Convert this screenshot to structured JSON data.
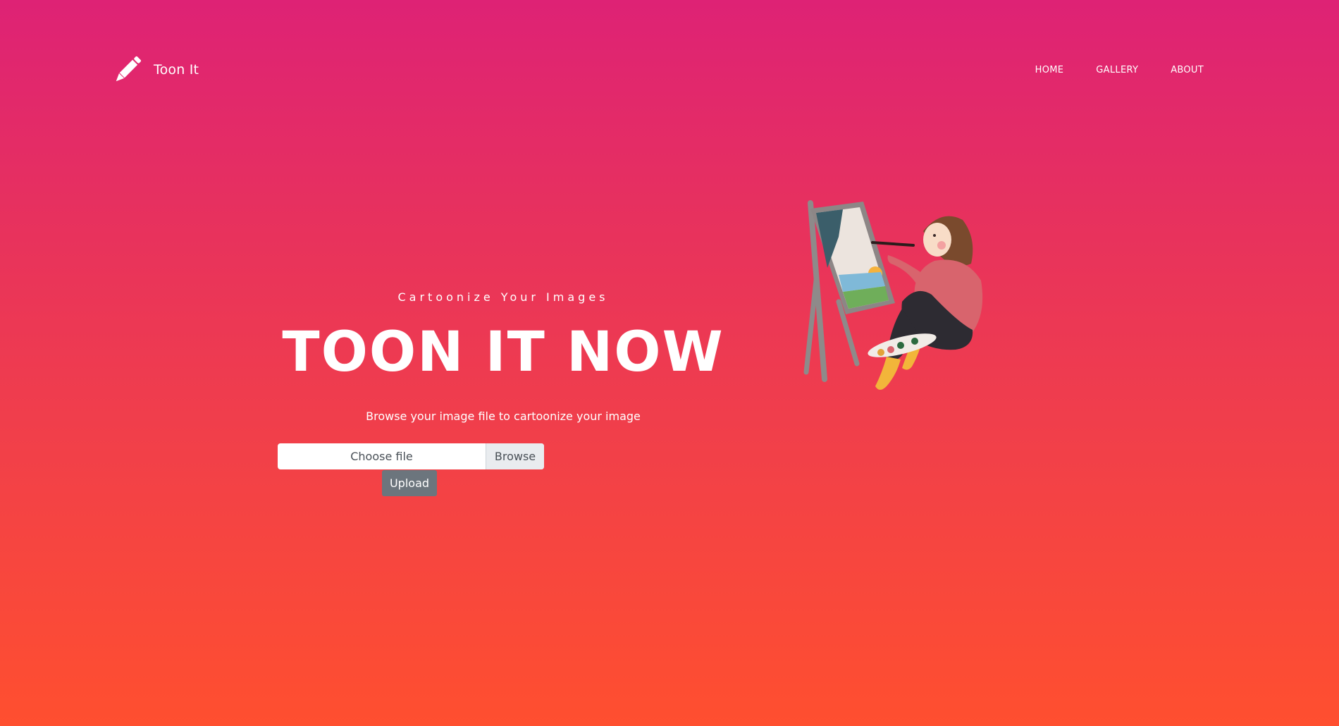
{
  "header": {
    "brand": "Toon It",
    "nav": [
      "HOME",
      "GALLERY",
      "ABOUT"
    ]
  },
  "hero": {
    "subtitle": "Cartoonize Your Images",
    "title": "TOON IT NOW",
    "description": "Browse your image file to cartoonize your image"
  },
  "upload_form": {
    "file_placeholder": "Choose file",
    "browse_label": "Browse",
    "upload_label": "Upload"
  },
  "icons": {
    "brand": "pencil-icon",
    "illustration": "girl-painting-illustration"
  },
  "colors": {
    "gradient_top": "#de2275",
    "gradient_bottom": "#ff4f2f",
    "upload_button": "#6c757d",
    "browse_button": "#e9ecef"
  }
}
